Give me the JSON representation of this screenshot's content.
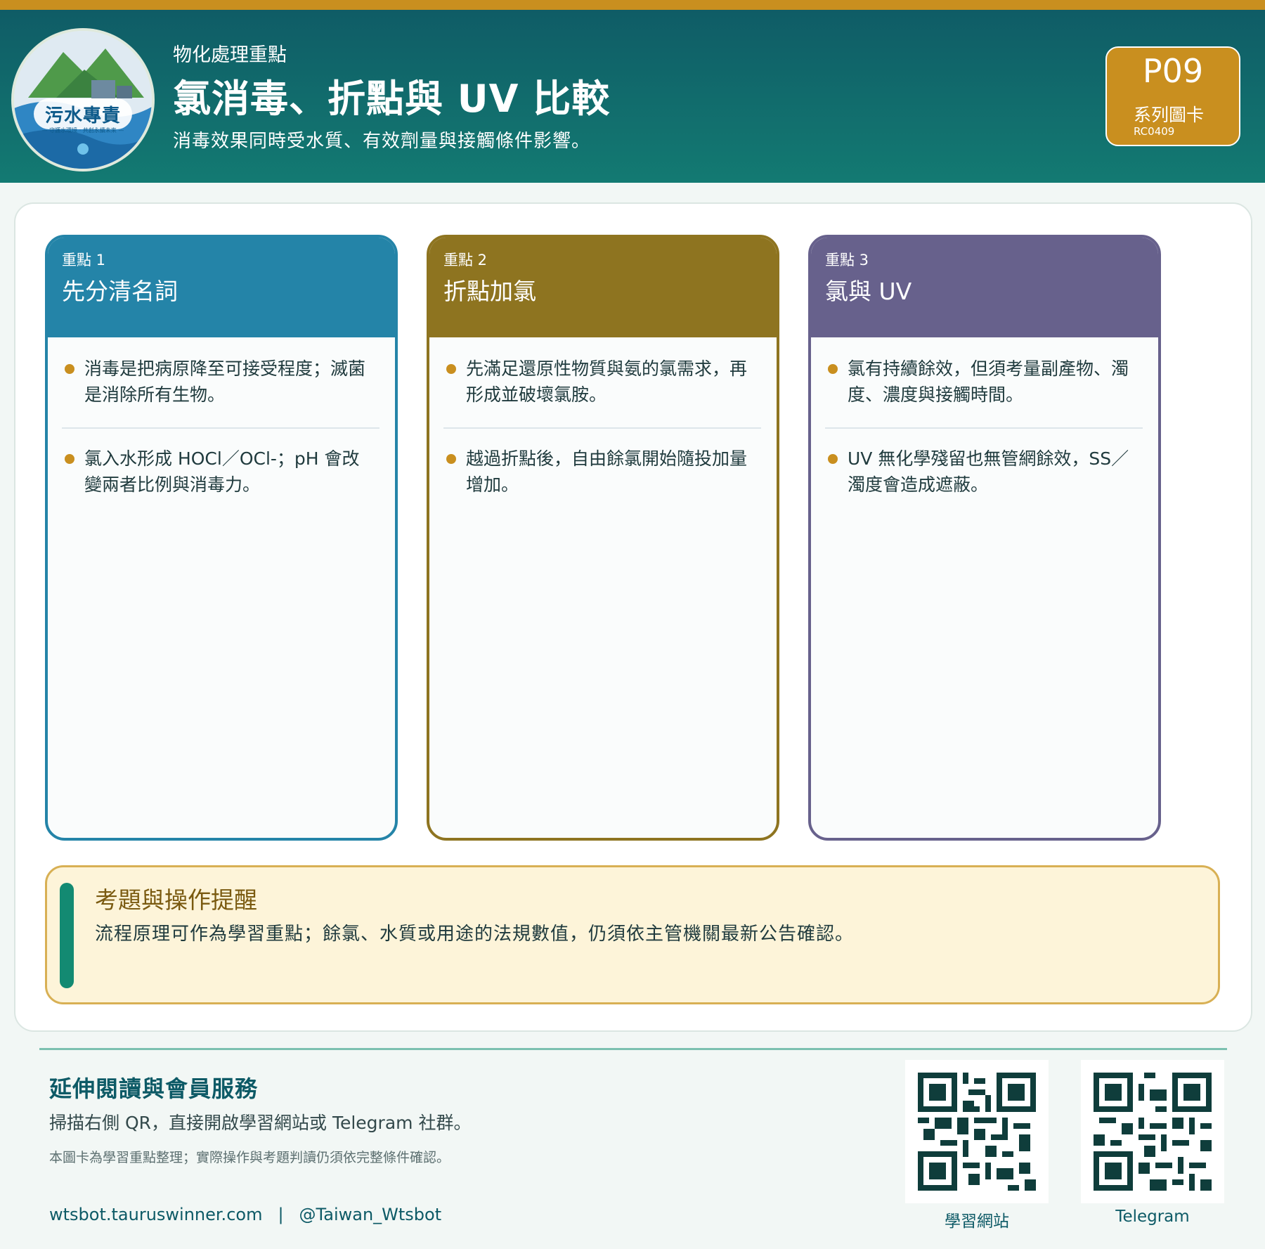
{
  "colors": {
    "accent": "#c98f1f",
    "header": "#0f5c66",
    "card1": "#2484a8",
    "card2": "#8e7420",
    "card3": "#67618c",
    "reminder_bar": "#138a72"
  },
  "logo": {
    "title": "污水專責",
    "subtitle": "— 守護水環境 · 共創永續未來 —"
  },
  "header": {
    "category": "物化處理重點",
    "title": "氯消毒、折點與 UV 比較",
    "subtitle": "消毒效果同時受水質、有效劑量與接觸條件影響。"
  },
  "badge": {
    "code": "P09",
    "label": "系列圖卡",
    "id": "RC0409"
  },
  "cards": [
    {
      "kicker": "重點 1",
      "title": "先分清名詞",
      "items": [
        "消毒是把病原降至可接受程度；滅菌是消除所有生物。",
        "氯入水形成 HOCl／OCl-；pH 會改變兩者比例與消毒力。"
      ]
    },
    {
      "kicker": "重點 2",
      "title": "折點加氯",
      "items": [
        "先滿足還原性物質與氨的氯需求，再形成並破壞氯胺。",
        "越過折點後，自由餘氯開始隨投加量增加。"
      ]
    },
    {
      "kicker": "重點 3",
      "title": "氯與 UV",
      "items": [
        "氯有持續餘效，但須考量副產物、濁度、濃度與接觸時間。",
        "UV 無化學殘留也無管網餘效，SS／濁度會造成遮蔽。"
      ]
    }
  ],
  "reminder": {
    "title": "考題與操作提醒",
    "text": "流程原理可作為學習重點；餘氯、水質或用途的法規數值，仍須依主管機關最新公告確認。"
  },
  "footer": {
    "title": "延伸閱讀與會員服務",
    "text": "掃描右側 QR，直接開啟學習網站或 Telegram 社群。",
    "note": "本圖卡為學習重點整理；實際操作與考題判讀仍須依完整條件確認。",
    "website": "wtsbot.tauruswinner.com",
    "separator": "|",
    "handle": "@Taiwan_Wtsbot",
    "qr1_label": "學習網站",
    "qr2_label": "Telegram"
  }
}
